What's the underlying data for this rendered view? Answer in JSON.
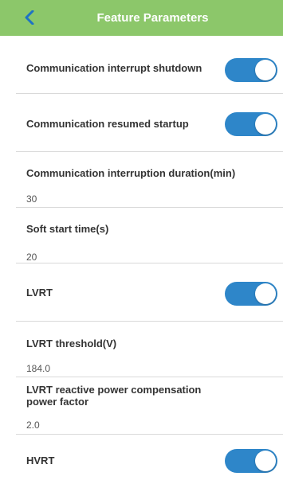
{
  "header": {
    "title": "Feature Parameters",
    "bg_color": "#8cc76a",
    "back_icon": "chevron-left-icon",
    "back_color": "#1e73c4"
  },
  "toggle_color": "#2e86c9",
  "rows": {
    "comm_interrupt_shutdown": {
      "label": "Communication interrupt shutdown",
      "on": true
    },
    "comm_resumed_startup": {
      "label": "Communication resumed startup",
      "on": true
    },
    "comm_interrupt_duration": {
      "label": "Communication interruption duration(min)",
      "value": "30"
    },
    "soft_start_time": {
      "label": "Soft start time(s)",
      "value": "20"
    },
    "lvrt": {
      "label": "LVRT",
      "on": true
    },
    "lvrt_threshold": {
      "label": "LVRT threshold(V)",
      "value": "184.0"
    },
    "lvrt_reactive_pf": {
      "label": "LVRT reactive power compensation power factor",
      "value": "2.0"
    },
    "hvrt": {
      "label": "HVRT",
      "on": true
    }
  }
}
